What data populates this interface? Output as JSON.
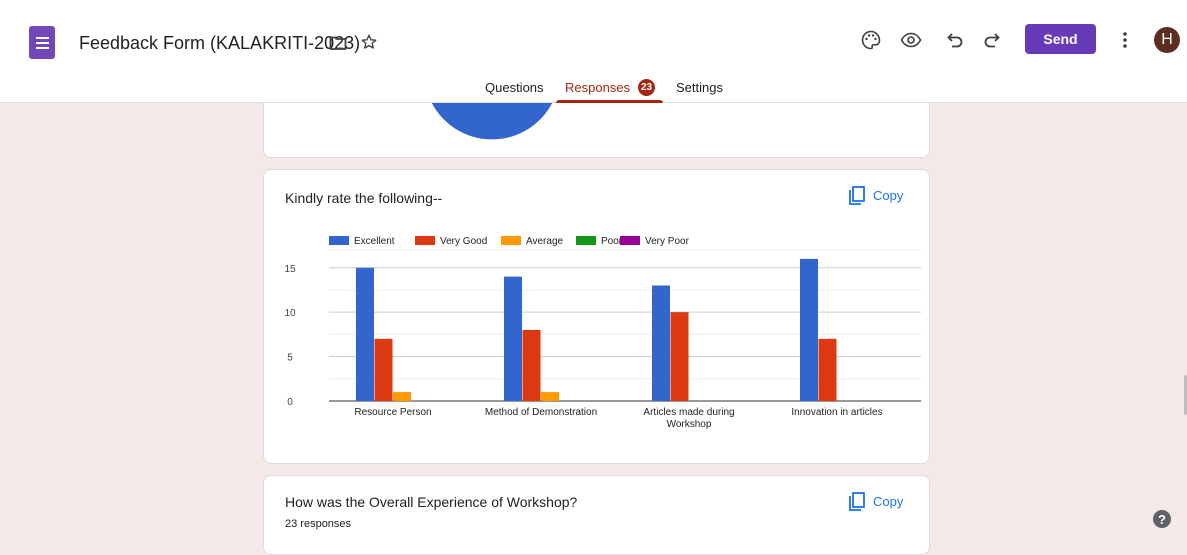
{
  "header": {
    "title": "Feedback Form (KALAKRITI-2023)",
    "send_label": "Send",
    "avatar_initial": "H",
    "tabs": [
      {
        "label": "Questions"
      },
      {
        "label": "Responses",
        "badge": "23"
      },
      {
        "label": "Settings"
      }
    ]
  },
  "cards": {
    "rating": {
      "title": "Kindly rate the following--",
      "copy_label": "Copy"
    },
    "overall": {
      "title": "How was the Overall Experience of  Workshop?",
      "copy_label": "Copy",
      "responses": "23 responses"
    }
  },
  "colors": {
    "brand": "#673ab7",
    "accent_tab": "#a52714",
    "background": "#f4e9e6"
  },
  "chart_data": {
    "type": "bar",
    "categories": [
      "Resource Person",
      "Method of Demonstration",
      "Articles made during Workshop",
      "Innovation in articles"
    ],
    "category_label_lines": [
      [
        "Resource Person"
      ],
      [
        "Method of Demonstration"
      ],
      [
        "Articles made during",
        "Workshop"
      ],
      [
        "Innovation in articles"
      ]
    ],
    "series": [
      {
        "name": "Excellent",
        "color": "#3366cc",
        "values": [
          15,
          14,
          13,
          16
        ]
      },
      {
        "name": "Very Good",
        "color": "#dc3912",
        "values": [
          7,
          8,
          10,
          7
        ]
      },
      {
        "name": "Average",
        "color": "#ff9900",
        "values": [
          1,
          1,
          0,
          0
        ]
      },
      {
        "name": "Poor",
        "color": "#109618",
        "values": [
          0,
          0,
          0,
          0
        ]
      },
      {
        "name": "Very Poor",
        "color": "#990099",
        "values": [
          0,
          0,
          0,
          0
        ]
      }
    ],
    "ylim": [
      0,
      17
    ],
    "yticks": [
      0,
      5,
      10,
      15
    ],
    "legend_position": "top",
    "grid": true
  }
}
